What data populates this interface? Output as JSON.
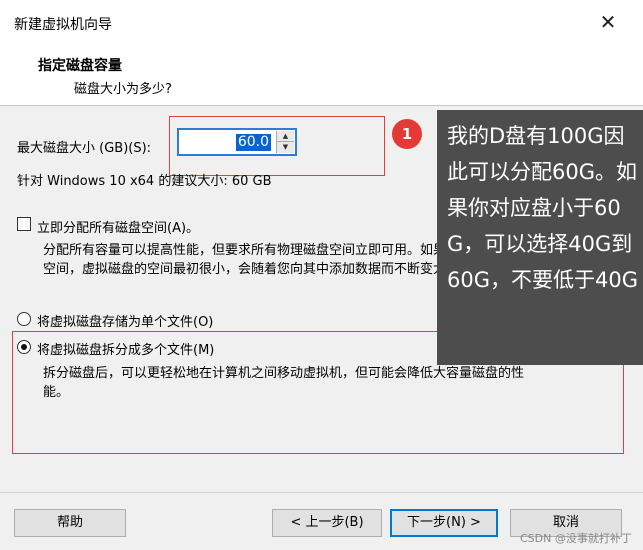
{
  "window": {
    "title": "新建虚拟机向导",
    "close_glyph": "✕"
  },
  "header": {
    "title": "指定磁盘容量",
    "subtitle": "磁盘大小为多少?"
  },
  "disk_size": {
    "label": "最大磁盘大小 (GB)(S):",
    "value": "60.0",
    "recommend": "针对 Windows 10 x64 的建议大小: 60 GB"
  },
  "allocate": {
    "label": "立即分配所有磁盘空间(A)。",
    "checked": false,
    "desc_line1": "分配所有容量可以提高性能，但要求所有物理磁盘空间立即可用。如果不立即分配所有",
    "desc_line2": "空间，虚拟磁盘的空间最初很小，会随着您向其中添加数据而不断变大。"
  },
  "storage": {
    "single_label": "将虚拟磁盘存储为单个文件(O)",
    "multi_label": "将虚拟磁盘拆分成多个文件(M)",
    "selected": "multi",
    "multi_desc_line1": "拆分磁盘后，可以更轻松地在计算机之间移动虚拟机，但可能会降低大容量磁盘的性",
    "multi_desc_line2": "能。"
  },
  "footer": {
    "help": "帮助",
    "back": "< 上一步(B)",
    "next": "下一步(N) >",
    "cancel": "取消"
  },
  "annotation": {
    "badge": "1",
    "text": "我的D盘有100G因此可以分配60G。如果你对应盘小于60G，可以选择40G到60G，不要低于40G"
  },
  "watermark": "CSDN @没事就打补丁",
  "colors": {
    "accent": "#0078d7",
    "highlight_box": "#e04040",
    "callout_bg": "#4d4d4d",
    "badge": "#e53935"
  }
}
